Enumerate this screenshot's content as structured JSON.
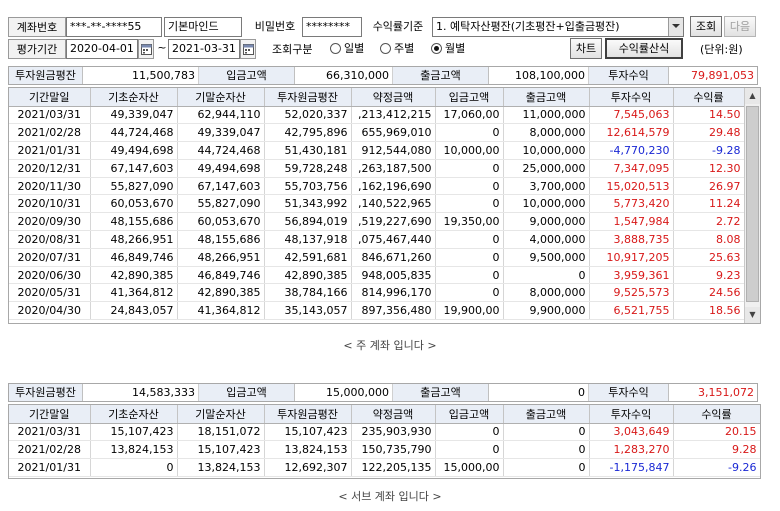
{
  "top": {
    "account_label": "계좌번호",
    "account_number": "***-**-****55",
    "account_name": "기본마인드",
    "password_label": "비밀번호",
    "password_mask": "********",
    "return_basis_label": "수익률기준",
    "return_basis_value": "1. 예탁자산평잔(기초평잔+입출금평잔)",
    "search_button": "조회",
    "next_button": "다음",
    "period_label": "평가기간",
    "date_from": "2020-04-01",
    "date_tilde": "~",
    "date_to": "2021-03-31",
    "query_type_label": "조회구분",
    "radio_daily": "일별",
    "radio_weekly": "주별",
    "radio_monthly": "월별",
    "chart_button": "차트",
    "formula_button": "수익률산식",
    "unit_label": "(단위:원)"
  },
  "main_summary": {
    "principal_avg_label": "투자원금평잔",
    "principal_avg_value": "11,500,783",
    "deposit_label": "입금고액",
    "deposit_value": "66,310,000",
    "withdraw_label": "출금고액",
    "withdraw_value": "108,100,000",
    "profit_label": "투자수익",
    "profit_value": "79,891,053"
  },
  "columns": [
    "기간말일",
    "기초순자산",
    "기말순자산",
    "투자원금평잔",
    "약정금액",
    "입금고액",
    "출금고액",
    "투자수익",
    "수익률"
  ],
  "main_rows": [
    {
      "date": "2021/03/31",
      "begin": "49,339,047",
      "end": "62,944,110",
      "principal": "52,020,337",
      "contract": ",213,412,215",
      "deposit": "17,060,00",
      "withdraw": "11,000,000",
      "profit": "7,545,063",
      "rate": "14.50",
      "sign": "pos"
    },
    {
      "date": "2021/02/28",
      "begin": "44,724,468",
      "end": "49,339,047",
      "principal": "42,795,896",
      "contract": "655,969,010",
      "deposit": "0",
      "withdraw": "8,000,000",
      "profit": "12,614,579",
      "rate": "29.48",
      "sign": "pos"
    },
    {
      "date": "2021/01/31",
      "begin": "49,494,698",
      "end": "44,724,468",
      "principal": "51,430,181",
      "contract": "912,544,080",
      "deposit": "10,000,00",
      "withdraw": "10,000,000",
      "profit": "-4,770,230",
      "rate": "-9.28",
      "sign": "neg"
    },
    {
      "date": "2020/12/31",
      "begin": "67,147,603",
      "end": "49,494,698",
      "principal": "59,728,248",
      "contract": ",263,187,500",
      "deposit": "0",
      "withdraw": "25,000,000",
      "profit": "7,347,095",
      "rate": "12.30",
      "sign": "pos"
    },
    {
      "date": "2020/11/30",
      "begin": "55,827,090",
      "end": "67,147,603",
      "principal": "55,703,756",
      "contract": ",162,196,690",
      "deposit": "0",
      "withdraw": "3,700,000",
      "profit": "15,020,513",
      "rate": "26.97",
      "sign": "pos"
    },
    {
      "date": "2020/10/31",
      "begin": "60,053,670",
      "end": "55,827,090",
      "principal": "51,343,992",
      "contract": ",140,522,965",
      "deposit": "0",
      "withdraw": "10,000,000",
      "profit": "5,773,420",
      "rate": "11.24",
      "sign": "pos"
    },
    {
      "date": "2020/09/30",
      "begin": "48,155,686",
      "end": "60,053,670",
      "principal": "56,894,019",
      "contract": ",519,227,690",
      "deposit": "19,350,00",
      "withdraw": "9,000,000",
      "profit": "1,547,984",
      "rate": "2.72",
      "sign": "pos"
    },
    {
      "date": "2020/08/31",
      "begin": "48,266,951",
      "end": "48,155,686",
      "principal": "48,137,918",
      "contract": ",075,467,440",
      "deposit": "0",
      "withdraw": "4,000,000",
      "profit": "3,888,735",
      "rate": "8.08",
      "sign": "pos"
    },
    {
      "date": "2020/07/31",
      "begin": "46,849,746",
      "end": "48,266,951",
      "principal": "42,591,681",
      "contract": "846,671,260",
      "deposit": "0",
      "withdraw": "9,500,000",
      "profit": "10,917,205",
      "rate": "25.63",
      "sign": "pos"
    },
    {
      "date": "2020/06/30",
      "begin": "42,890,385",
      "end": "46,849,746",
      "principal": "42,890,385",
      "contract": "948,005,835",
      "deposit": "0",
      "withdraw": "0",
      "profit": "3,959,361",
      "rate": "9.23",
      "sign": "pos"
    },
    {
      "date": "2020/05/31",
      "begin": "41,364,812",
      "end": "42,890,385",
      "principal": "38,784,166",
      "contract": "814,996,170",
      "deposit": "0",
      "withdraw": "8,000,000",
      "profit": "9,525,573",
      "rate": "24.56",
      "sign": "pos"
    },
    {
      "date": "2020/04/30",
      "begin": "24,843,057",
      "end": "41,364,812",
      "principal": "35,143,057",
      "contract": "897,356,480",
      "deposit": "19,900,00",
      "withdraw": "9,900,000",
      "profit": "6,521,755",
      "rate": "18.56",
      "sign": "pos"
    }
  ],
  "main_note": "< 주 계좌 입니다 >",
  "sub_summary": {
    "principal_avg_label": "투자원금평잔",
    "principal_avg_value": "14,583,333",
    "deposit_label": "입금고액",
    "deposit_value": "15,000,000",
    "withdraw_label": "출금고액",
    "withdraw_value": "0",
    "profit_label": "투자수익",
    "profit_value": "3,151,072"
  },
  "sub_rows": [
    {
      "date": "2021/03/31",
      "begin": "15,107,423",
      "end": "18,151,072",
      "principal": "15,107,423",
      "contract": "235,903,930",
      "deposit": "0",
      "withdraw": "0",
      "profit": "3,043,649",
      "rate": "20.15",
      "sign": "pos"
    },
    {
      "date": "2021/02/28",
      "begin": "13,824,153",
      "end": "15,107,423",
      "principal": "13,824,153",
      "contract": "150,735,790",
      "deposit": "0",
      "withdraw": "0",
      "profit": "1,283,270",
      "rate": "9.28",
      "sign": "pos"
    },
    {
      "date": "2021/01/31",
      "begin": "0",
      "end": "13,824,153",
      "principal": "12,692,307",
      "contract": "122,205,135",
      "deposit": "15,000,00",
      "withdraw": "0",
      "profit": "-1,175,847",
      "rate": "-9.26",
      "sign": "neg"
    }
  ],
  "sub_note": "< 서브 계좌 입니다 >",
  "colors": {
    "positive": "#d81818",
    "negative": "#1a28d4",
    "header_bg": "#e9eef6"
  }
}
